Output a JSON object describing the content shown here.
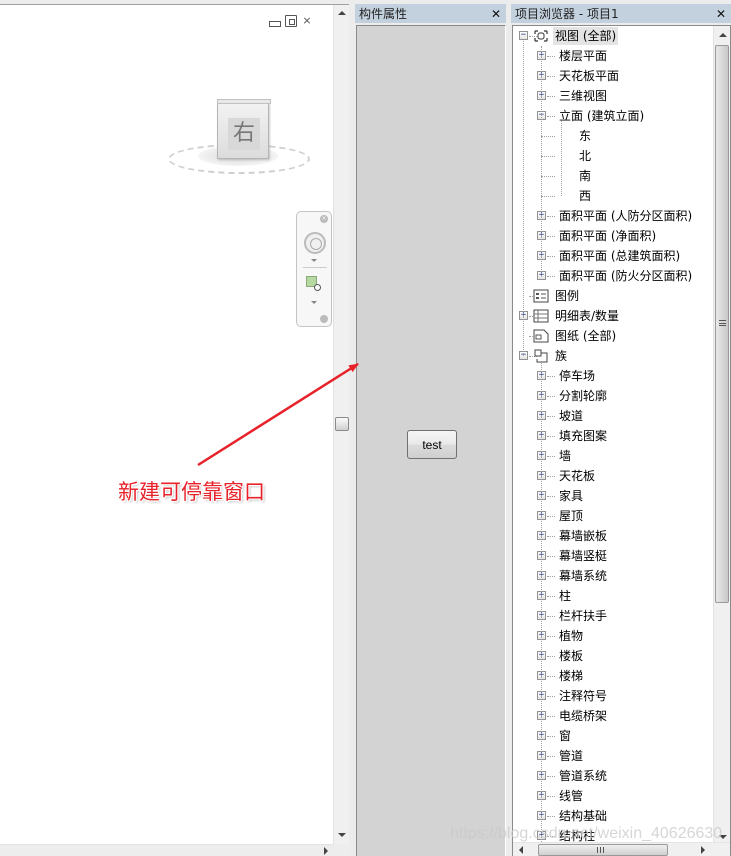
{
  "view": {
    "window_controls": [
      "minimize",
      "restore",
      "close"
    ],
    "viewcube_face": "右",
    "annotation_text": "新建可停靠窗口",
    "annotation_color": "#e8222a"
  },
  "properties_panel": {
    "title": "构件属性",
    "close_glyph": "✕",
    "test_button_label": "test"
  },
  "project_browser": {
    "title": "项目浏览器 - 项目1",
    "close_glyph": "✕",
    "tree": [
      {
        "label": "视图 (全部)",
        "level": 0,
        "expander": "minus",
        "icon": "views-icon",
        "selected": true
      },
      {
        "label": "楼层平面",
        "level": 1,
        "expander": "plus"
      },
      {
        "label": "天花板平面",
        "level": 1,
        "expander": "plus"
      },
      {
        "label": "三维视图",
        "level": 1,
        "expander": "plus"
      },
      {
        "label": "立面 (建筑立面)",
        "level": 1,
        "expander": "minus"
      },
      {
        "label": "东",
        "level": 2
      },
      {
        "label": "北",
        "level": 2
      },
      {
        "label": "南",
        "level": 2
      },
      {
        "label": "西",
        "level": 2
      },
      {
        "label": "面积平面 (人防分区面积)",
        "level": 1,
        "expander": "plus"
      },
      {
        "label": "面积平面 (净面积)",
        "level": 1,
        "expander": "plus"
      },
      {
        "label": "面积平面 (总建筑面积)",
        "level": 1,
        "expander": "plus"
      },
      {
        "label": "面积平面 (防火分区面积)",
        "level": 1,
        "expander": "plus"
      },
      {
        "label": "图例",
        "level": 0,
        "icon": "legend-icon"
      },
      {
        "label": "明细表/数量",
        "level": 0,
        "expander": "plus",
        "icon": "schedule-icon"
      },
      {
        "label": "图纸 (全部)",
        "level": 0,
        "icon": "sheets-icon"
      },
      {
        "label": "族",
        "level": 0,
        "expander": "minus",
        "icon": "families-icon"
      },
      {
        "label": "停车场",
        "level": 1,
        "expander": "plus"
      },
      {
        "label": "分割轮廓",
        "level": 1,
        "expander": "plus"
      },
      {
        "label": "坡道",
        "level": 1,
        "expander": "plus"
      },
      {
        "label": "填充图案",
        "level": 1,
        "expander": "plus"
      },
      {
        "label": "墙",
        "level": 1,
        "expander": "plus"
      },
      {
        "label": "天花板",
        "level": 1,
        "expander": "plus"
      },
      {
        "label": "家具",
        "level": 1,
        "expander": "plus"
      },
      {
        "label": "屋顶",
        "level": 1,
        "expander": "plus"
      },
      {
        "label": "幕墙嵌板",
        "level": 1,
        "expander": "plus"
      },
      {
        "label": "幕墙竖梃",
        "level": 1,
        "expander": "plus"
      },
      {
        "label": "幕墙系统",
        "level": 1,
        "expander": "plus"
      },
      {
        "label": "柱",
        "level": 1,
        "expander": "plus"
      },
      {
        "label": "栏杆扶手",
        "level": 1,
        "expander": "plus"
      },
      {
        "label": "植物",
        "level": 1,
        "expander": "plus"
      },
      {
        "label": "楼板",
        "level": 1,
        "expander": "plus"
      },
      {
        "label": "楼梯",
        "level": 1,
        "expander": "plus"
      },
      {
        "label": "注释符号",
        "level": 1,
        "expander": "plus"
      },
      {
        "label": "电缆桥架",
        "level": 1,
        "expander": "plus"
      },
      {
        "label": "窗",
        "level": 1,
        "expander": "plus"
      },
      {
        "label": "管道",
        "level": 1,
        "expander": "plus"
      },
      {
        "label": "管道系统",
        "level": 1,
        "expander": "plus"
      },
      {
        "label": "线管",
        "level": 1,
        "expander": "plus"
      },
      {
        "label": "结构基础",
        "level": 1,
        "expander": "plus"
      },
      {
        "label": "结构柱",
        "level": 1,
        "expander": "plus"
      }
    ]
  },
  "watermark": "https://blog.csdn.net/weixin_40626630"
}
